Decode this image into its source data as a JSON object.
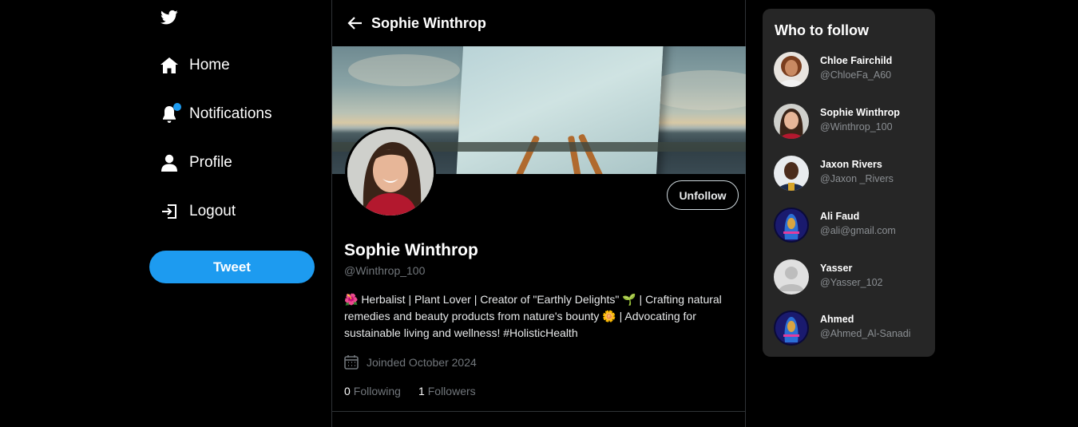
{
  "sidebar": {
    "logo_icon": "twitter-bird-icon",
    "items": [
      {
        "label": "Home",
        "icon": "home-icon"
      },
      {
        "label": "Notifications",
        "icon": "bell-icon"
      },
      {
        "label": "Profile",
        "icon": "user-icon"
      },
      {
        "label": "Logout",
        "icon": "logout-icon"
      }
    ],
    "tweet_label": "Tweet"
  },
  "header": {
    "back_icon": "arrow-left-icon",
    "title": "Sophie Winthrop"
  },
  "profile": {
    "name": "Sophie Winthrop",
    "handle": "@Winthrop_100",
    "action_label": "Unfollow",
    "bio": "🌺 Herbalist | Plant Lover | Creator of \"Earthly Delights\" 🌱 | Crafting natural remedies and beauty products from nature's bounty 🌼 | Advocating for sustainable living and wellness! #HolisticHealth",
    "joined": "Joinded October 2024",
    "following_count": "0",
    "following_label": "Following",
    "followers_count": "1",
    "followers_label": "Followers"
  },
  "who_to_follow": {
    "title": "Who to follow",
    "users": [
      {
        "name": "Chloe Fairchild",
        "handle": "@ChloeFa_A60"
      },
      {
        "name": "Sophie Winthrop",
        "handle": "@Winthrop_100"
      },
      {
        "name": "Jaxon Rivers",
        "handle": "@Jaxon _Rivers"
      },
      {
        "name": "Ali Faud",
        "handle": "@ali@gmail.com"
      },
      {
        "name": "Yasser",
        "handle": "@Yasser_102"
      },
      {
        "name": "Ahmed",
        "handle": "@Ahmed_Al-Sanadi"
      }
    ]
  },
  "colors": {
    "accent": "#1d9bf0",
    "background": "#000000",
    "panel": "#262626",
    "muted_text": "#71767b"
  }
}
